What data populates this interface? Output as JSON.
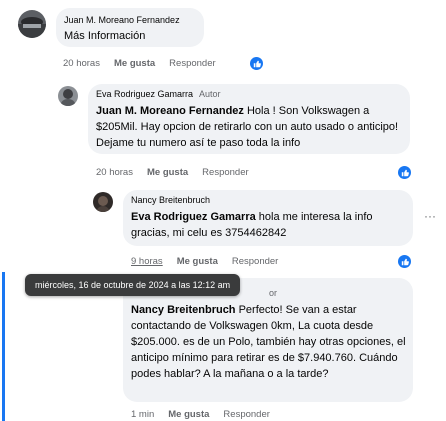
{
  "comments": [
    {
      "author": "Juan M. Moreano Fernandez",
      "badge": "",
      "mention": "",
      "text": "Más Información",
      "time": "20 horas",
      "like": "Me gusta",
      "reply": "Responder"
    },
    {
      "author": "Eva Rodriguez Gamarra",
      "badge": "Autor",
      "mention": "Juan M. Moreano Fernandez",
      "text": " Hola ! Son Volkswagen a $205Mil. Hay opcion de retirarlo con un auto usado o anticipo! Dejame tu numero así te paso toda la info",
      "time": "20 horas",
      "like": "Me gusta",
      "reply": "Responder"
    },
    {
      "author": "Nancy Breitenbruch",
      "badge": "",
      "mention": "Eva Rodriguez Gamarra",
      "text": " hola me interesa la info gracias, mi celu es 3754462842",
      "time": "9 horas",
      "like": "Me gusta",
      "reply": "Responder"
    },
    {
      "author": "Eva Rodriguez Gamarra",
      "badge": "Autor",
      "mention": "Nancy Breitenbruch",
      "text": " Perfecto! Se van a estar contactando de Volkswagen 0km, La cuota desde $205.000. es de un Polo, también hay otras opciones, el anticipo mínimo para retirar es de $7.940.760. Cuándo podes hablar? A la mañana o a la tarde?",
      "time": "1 min",
      "like": "Me gusta",
      "reply": "Responder"
    }
  ],
  "tooltip": "miércoles, 16 de octubre de 2024 a las 12:12 am",
  "more_options": "···",
  "partial_badge": "or",
  "icons": {
    "reaction": "like-reaction-icon",
    "more": "more-options-icon"
  },
  "colors": {
    "accent": "#1877f2",
    "bubble": "#f0f2f5",
    "muted": "#65676b",
    "tooltip": "#3a3b3c"
  }
}
